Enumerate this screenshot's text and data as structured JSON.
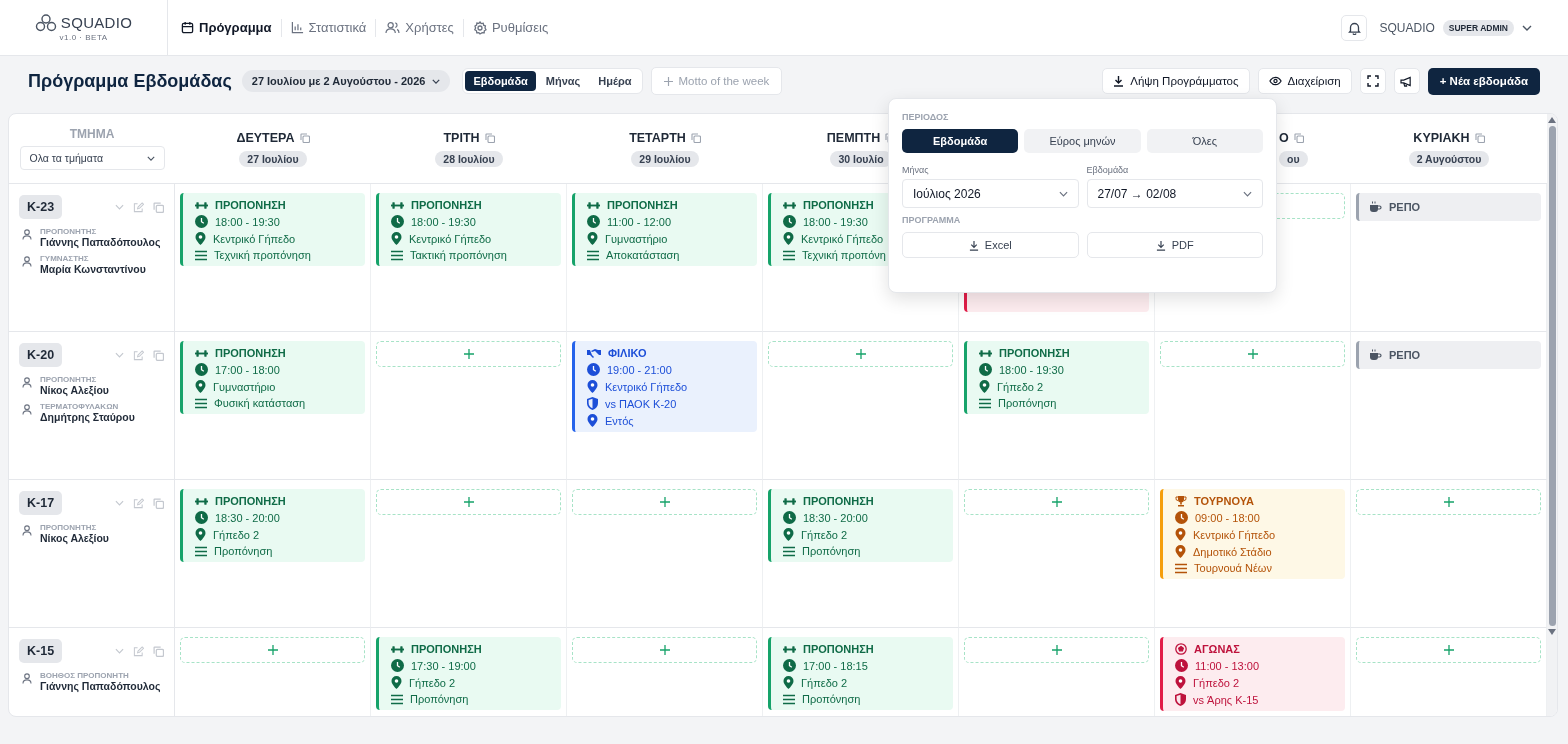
{
  "brand": {
    "name": "SQUADIO",
    "version": "v1.0 · BETA"
  },
  "nav": [
    {
      "kind": "schedule",
      "label": "Πρόγραμμα",
      "selected": true
    },
    {
      "kind": "stats",
      "label": "Στατιστικά",
      "selected": false
    },
    {
      "kind": "users",
      "label": "Χρήστες",
      "selected": false
    },
    {
      "kind": "settings",
      "label": "Ρυθμίσεις",
      "selected": false
    }
  ],
  "user": {
    "name": "SQUADIO",
    "role": "SUPER ADMIN"
  },
  "toolbar": {
    "title": "Πρόγραμμα Εβδομάδας",
    "week": "27 Ιουλίου με 2 Αυγούστου - 2026",
    "views": [
      {
        "label": "Εβδομάδα",
        "selected": true
      },
      {
        "label": "Μήνας",
        "selected": false
      },
      {
        "label": "Ημέρα",
        "selected": false
      }
    ],
    "motto_button": "Motto of the week",
    "download_button": "Λήψη Προγράμματος",
    "manage_button": "Διαχείριση",
    "new_week_button": "+ Νέα εβδομάδα"
  },
  "grid": {
    "team_heading": "ΤΜΗΜΑ",
    "team_filter": "Ολα τα τμήματα",
    "days": [
      {
        "name": "ΔΕΥΤΕΡΑ",
        "date": "27 Ιουλίου"
      },
      {
        "name": "ΤΡΙΤΗ",
        "date": "28 Ιουλίου"
      },
      {
        "name": "ΤΕΤΑΡΤΗ",
        "date": "29 Ιουλίου"
      },
      {
        "name": "ΠΕΜΠΤΗ",
        "date": "30 Ιουλίο"
      },
      {
        "kind": "covered"
      },
      {
        "kind": "covered",
        "name": "Ο",
        "date": "ου"
      },
      {
        "name": "ΚΥΡΙΑΚΗ",
        "date": "2 Αυγούστου"
      }
    ],
    "rows": [
      {
        "team": "Κ-23",
        "staff": [
          {
            "role": "ΠΡΟΠΟΝΗΤΗΣ",
            "name": "Γιάννης Παπαδόπουλος"
          },
          {
            "role": "ΓΥΜΝΑΣΤΗΣ",
            "name": "Μαρία Κωνσταντίνου"
          }
        ],
        "cells": [
          {
            "kind": "training",
            "title": "ΠΡΟΠΟΝΗΣΗ",
            "lines": [
              {
                "kind": "time",
                "text": "18:00 - 19:30"
              },
              {
                "kind": "place",
                "text": "Κεντρικό Γήπεδο"
              },
              {
                "kind": "note",
                "text": "Τεχνική προπόνηση"
              }
            ]
          },
          {
            "kind": "training",
            "title": "ΠΡΟΠΟΝΗΣΗ",
            "lines": [
              {
                "kind": "time",
                "text": "18:00 - 19:30"
              },
              {
                "kind": "place",
                "text": "Κεντρικό Γήπεδο"
              },
              {
                "kind": "note",
                "text": "Τακτική προπόνηση"
              }
            ]
          },
          {
            "kind": "training",
            "title": "ΠΡΟΠΟΝΗΣΗ",
            "lines": [
              {
                "kind": "time",
                "text": "11:00 - 12:00"
              },
              {
                "kind": "place",
                "text": "Γυμναστήριο"
              },
              {
                "kind": "note",
                "text": "Αποκατάσταση"
              }
            ]
          },
          {
            "kind": "training",
            "title": "ΠΡΟΠΟΝΗΣΗ",
            "lines": [
              {
                "kind": "time",
                "text": "18:00 - 19:30"
              },
              {
                "kind": "place",
                "text": "Κεντρικό Γήπεδο"
              },
              {
                "kind": "note",
                "text": "Τεχνική προπόνη"
              }
            ]
          },
          {
            "kind": "match"
          },
          {
            "kind": "add_slot"
          },
          {
            "kind": "rest",
            "title": "ΡΕΠΟ"
          }
        ]
      },
      {
        "team": "Κ-20",
        "staff": [
          {
            "role": "ΠΡΟΠΟΝΗΤΗΣ",
            "name": "Νίκος Αλεξίου"
          },
          {
            "role": "ΤΕΡΜΑΤΟΦΥΛΑΚΩΝ",
            "name": "Δημήτρης Σταύρου"
          }
        ],
        "cells": [
          {
            "kind": "training",
            "title": "ΠΡΟΠΟΝΗΣΗ",
            "lines": [
              {
                "kind": "time",
                "text": "17:00 - 18:00"
              },
              {
                "kind": "place",
                "text": "Γυμναστήριο"
              },
              {
                "kind": "note",
                "text": "Φυσική κατάσταση"
              }
            ]
          },
          {
            "kind": "add_slot"
          },
          {
            "kind": "friendly",
            "title": "ΦΙΛΙΚΟ",
            "lines": [
              {
                "kind": "time",
                "text": "19:00 - 21:00"
              },
              {
                "kind": "place",
                "text": "Κεντρικό Γήπεδο"
              },
              {
                "kind": "opponent",
                "text": "vs ΠΑΟΚ Κ-20"
              },
              {
                "kind": "place",
                "text": "Εντός"
              }
            ]
          },
          {
            "kind": "add_slot"
          },
          {
            "kind": "training",
            "title": "ΠΡΟΠΟΝΗΣΗ",
            "lines": [
              {
                "kind": "time",
                "text": "18:00 - 19:30"
              },
              {
                "kind": "place",
                "text": "Γήπεδο 2"
              },
              {
                "kind": "note",
                "text": "Προπόνηση"
              }
            ]
          },
          {
            "kind": "add_slot"
          },
          {
            "kind": "rest",
            "title": "ΡΕΠΟ"
          }
        ]
      },
      {
        "team": "Κ-17",
        "staff": [
          {
            "role": "ΠΡΟΠΟΝΗΤΗΣ",
            "name": "Νίκος Αλεξίου"
          }
        ],
        "cells": [
          {
            "kind": "training",
            "title": "ΠΡΟΠΟΝΗΣΗ",
            "lines": [
              {
                "kind": "time",
                "text": "18:30 - 20:00"
              },
              {
                "kind": "place",
                "text": "Γήπεδο 2"
              },
              {
                "kind": "note",
                "text": "Προπόνηση"
              }
            ]
          },
          {
            "kind": "add_slot"
          },
          {
            "kind": "add_slot"
          },
          {
            "kind": "training",
            "title": "ΠΡΟΠΟΝΗΣΗ",
            "lines": [
              {
                "kind": "time",
                "text": "18:30 - 20:00"
              },
              {
                "kind": "place",
                "text": "Γήπεδο 2"
              },
              {
                "kind": "note",
                "text": "Προπόνηση"
              }
            ]
          },
          {
            "kind": "add_slot"
          },
          {
            "kind": "tournament",
            "title": "ΤΟΥΡΝΟΥΑ",
            "lines": [
              {
                "kind": "time",
                "text": "09:00 - 18:00"
              },
              {
                "kind": "place",
                "text": "Κεντρικό Γήπεδο"
              },
              {
                "kind": "place",
                "text": "Δημοτικό Στάδιο"
              },
              {
                "kind": "note",
                "text": "Τουρνουά Νέων"
              }
            ]
          },
          {
            "kind": "add_slot"
          }
        ]
      },
      {
        "team": "Κ-15",
        "staff": [
          {
            "role": "ΒΟΗΘΟΣ ΠΡΟΠΟΝΗΤΗ",
            "name": "Γιάννης Παπαδόπουλος"
          }
        ],
        "cells": [
          {
            "kind": "add_slot"
          },
          {
            "kind": "training",
            "title": "ΠΡΟΠΟΝΗΣΗ",
            "lines": [
              {
                "kind": "time",
                "text": "17:30 - 19:00"
              },
              {
                "kind": "place",
                "text": "Γήπεδο 2"
              },
              {
                "kind": "note",
                "text": "Προπόνηση"
              }
            ]
          },
          {
            "kind": "add_slot"
          },
          {
            "kind": "training",
            "title": "ΠΡΟΠΟΝΗΣΗ",
            "lines": [
              {
                "kind": "time",
                "text": "17:00 - 18:15"
              },
              {
                "kind": "place",
                "text": "Γήπεδο 2"
              },
              {
                "kind": "note",
                "text": "Προπόνηση"
              }
            ]
          },
          {
            "kind": "add_slot"
          },
          {
            "kind": "match",
            "title": "ΑΓΩΝΑΣ",
            "lines": [
              {
                "kind": "time",
                "text": "11:00 - 13:00"
              },
              {
                "kind": "place",
                "text": "Γήπεδο 2"
              },
              {
                "kind": "opponent",
                "text": "vs Άρης Κ-15"
              }
            ]
          },
          {
            "kind": "add_slot"
          }
        ]
      }
    ]
  },
  "period_popup": {
    "period_heading": "ΠΕΡΙΟΔΟΣ",
    "periods": [
      {
        "label": "Εβδομάδα",
        "selected": true
      },
      {
        "label": "Εύρος μηνών",
        "selected": false
      },
      {
        "label": "Όλες",
        "selected": false
      }
    ],
    "month_label": "Μήνας",
    "month_value": "Ιούλιος 2026",
    "week_label": "Εβδομάδα",
    "week_value": "27/07 → 02/08",
    "export_heading": "ΠΡΟΓΡΑΜΜΑ",
    "export_buttons": [
      "Excel",
      "PDF"
    ]
  }
}
